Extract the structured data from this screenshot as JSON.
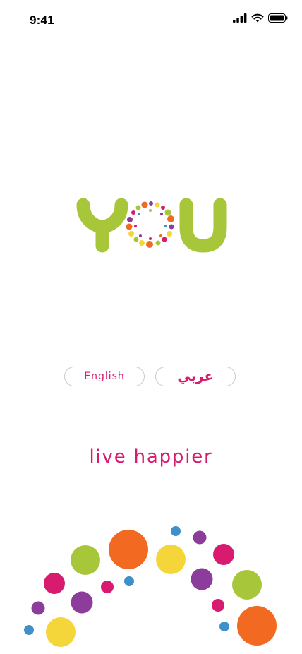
{
  "status_bar": {
    "time": "9:41",
    "icons": [
      "cellular-signal-icon",
      "wifi-icon",
      "battery-icon"
    ]
  },
  "logo": {
    "word": "YOU",
    "tagline": "live happier",
    "colors": {
      "green": "#a8c63a",
      "magenta": "#d81b6f",
      "orange": "#f26a21",
      "yellow": "#f5d63a",
      "purple": "#8c3c9a",
      "blue": "#3f8fc9"
    }
  },
  "language": {
    "english_label": "English",
    "arabic_label": "عربي"
  }
}
